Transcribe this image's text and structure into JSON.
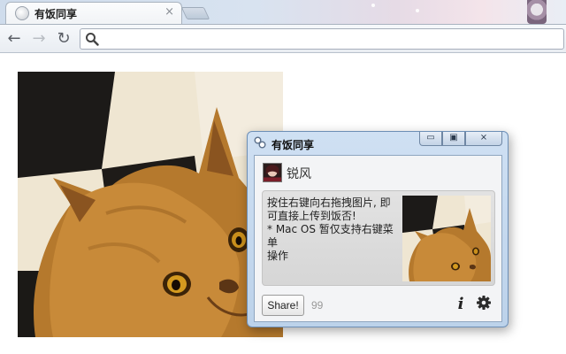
{
  "browser": {
    "tab_title": "有饭同享",
    "tab_close": "×",
    "nav": {
      "back": "←",
      "forward": "→",
      "reload": "↻"
    },
    "address": ""
  },
  "popup": {
    "title": "有饭同享",
    "window_buttons": {
      "minimize": "▭",
      "restore": "▣",
      "close": "⨯"
    },
    "user_name": "锐风",
    "message_lines": [
      "按住右键向右拖拽图片, 即",
      "可直接上传到饭否!",
      "* Mac OS 暂仅支持右键菜单",
      "操作"
    ],
    "share_label": "Share!",
    "share_count": "99",
    "info_label": "i"
  },
  "icons": [
    "chrome-favicon",
    "back-arrow-icon",
    "forward-arrow-icon",
    "reload-icon",
    "search-icon",
    "extension-icon",
    "info-icon",
    "gear-icon"
  ]
}
